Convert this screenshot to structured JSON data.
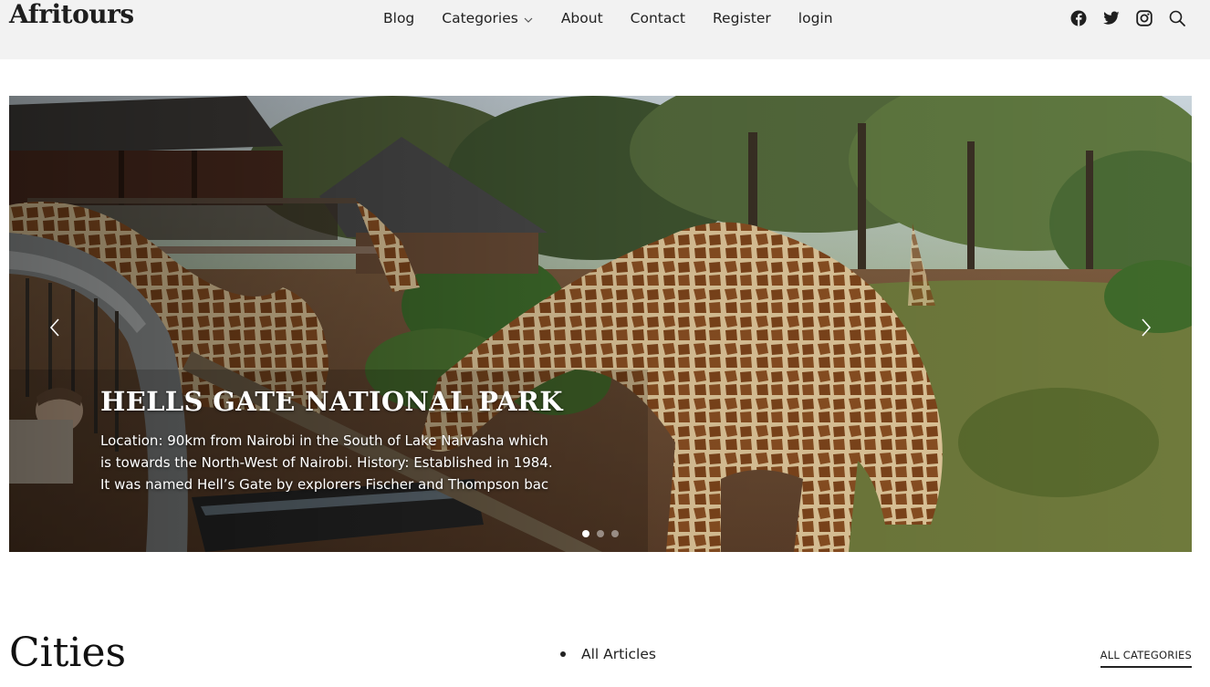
{
  "header": {
    "logo": "Afritours",
    "nav": [
      {
        "label": "Blog"
      },
      {
        "label": "Categories",
        "has_dropdown": true
      },
      {
        "label": "About"
      },
      {
        "label": "Contact"
      },
      {
        "label": "Register"
      },
      {
        "label": "login"
      }
    ],
    "social_icons": [
      "facebook-icon",
      "twitter-icon",
      "instagram-icon",
      "search-icon"
    ]
  },
  "slider": {
    "slide_title": "HELLS GATE NATIONAL PARK",
    "slide_text": "Location: 90km from Nairobi in the South of Lake Naivasha which is towards the North-West of Nairobi. History: Established in 1984. It was named Hell’s Gate by explorers Fischer and Thompson bac",
    "dots_count": 3,
    "active_dot": 1
  },
  "section": {
    "title": "Cities",
    "list_item": "All Articles",
    "all_categories": "ALL CATEGORIES"
  },
  "colors": {
    "header_bg": "#f2f2f2",
    "text": "#222222",
    "caption_text": "#ffffff"
  }
}
